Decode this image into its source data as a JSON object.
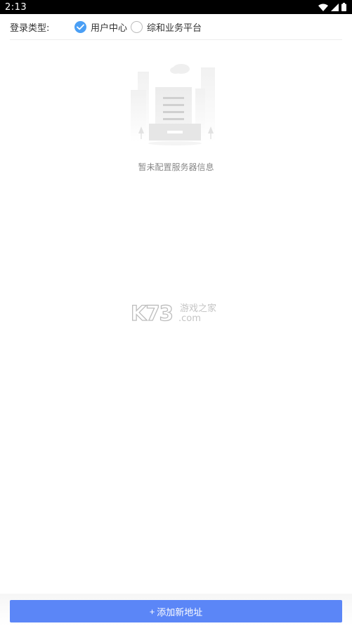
{
  "status_bar": {
    "time": "2:13",
    "icons": [
      "wifi-icon",
      "signal-icon",
      "battery-icon"
    ]
  },
  "login_type": {
    "label": "登录类型:",
    "options": [
      {
        "label": "用户中心",
        "checked": true
      },
      {
        "label": "综和业务平台",
        "checked": false
      }
    ]
  },
  "empty_state": {
    "message": "暂未配置服务器信息",
    "icon": "document-tray-illustration"
  },
  "watermark": {
    "main": "K73",
    "cn": "游戏之家",
    "domain": ".com"
  },
  "footer": {
    "plus": "+",
    "add_label": "添加新地址"
  },
  "colors": {
    "accent": "#5b86f7",
    "radio_checked": "#4a9ff5",
    "status_bar": "#000000"
  }
}
